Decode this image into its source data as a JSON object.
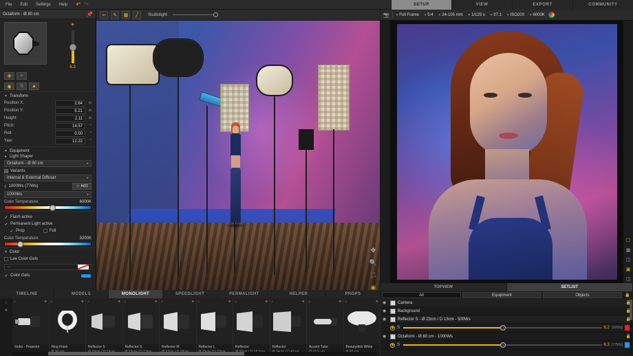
{
  "menu": {
    "items": [
      "File",
      "Edit",
      "Settings",
      "Help"
    ],
    "undo_icon": "undo-arrow-icon",
    "redo_icon": "redo-arrow-icon"
  },
  "topnav": {
    "tabs": [
      "SETUP",
      "VIEW",
      "EXPORT",
      "COMMUNITY"
    ],
    "active": "SETUP"
  },
  "left_panel": {
    "title": "Octaform - Ø 80 cm",
    "pin_icon": "pin-icon",
    "preview_icon": "octabox-preview-icon",
    "power_value": "6.3",
    "icon_row_1": [
      "move-icon",
      "target-icon"
    ],
    "icon_row_2": [
      "power-icon",
      "sync-icon",
      "tripod-icon"
    ],
    "transform": {
      "title": "Transform",
      "rows": [
        {
          "label": "Position X:",
          "value": "2.64",
          "unit": "m"
        },
        {
          "label": "Position Y:",
          "value": "5.21",
          "unit": "m"
        },
        {
          "label": "Height:",
          "value": "2.11",
          "unit": "m"
        },
        {
          "label": "Pitch:",
          "value": "14.57",
          "unit": "°"
        },
        {
          "label": "Roll:",
          "value": "0.00",
          "unit": "°"
        },
        {
          "label": "Yaw:",
          "value": "12.22",
          "unit": "°"
        }
      ]
    },
    "equipment": {
      "title": "Equipment",
      "light_shaper_label": "Light Shaper",
      "light_shaper_value": "Octaform - Ø 80 cm",
      "variants_label": "Variants",
      "variants_value": "Internal & External Diffuser",
      "watt_label": "1000Ws (77Ws)",
      "add_button": "ADD",
      "generator_value": "1000Ws",
      "color_temp_label": "Color Temperature",
      "color_temp_value": "6000K"
    },
    "flash": {
      "flash_active": "Flash active",
      "permanent_active": "Permanent Light active",
      "prop": "Prop",
      "full": "Full",
      "color_temp_label": "Color Temperature",
      "color_temp_value": "3200K"
    },
    "color": {
      "title": "Color",
      "lee_gels_label": "Lee Color Gels",
      "lee_gels_value": "---",
      "color_gels_label": "Color Gels",
      "color_gels_swatch": "#1e9ae8"
    }
  },
  "viewport_toolbar": {
    "icons": [
      "cursor-icon",
      "pen-icon",
      "grid-icon",
      "ruler-icon"
    ],
    "studiolight_label": "Studiolight"
  },
  "viewport": {
    "icons": [
      "move-tool-icon",
      "zoom-tool-icon",
      "fullscreen-icon",
      "orbit-icon"
    ]
  },
  "camera_bar": {
    "camera_icon": "camera-icon",
    "settings": [
      "Full Frame",
      "5:4",
      "24-105 mm",
      "1/125 s",
      "f/7.1",
      "ISO200",
      "6000K"
    ],
    "color_icon": "color-wheel-icon"
  },
  "right_side_icons": [
    "crop-icon",
    "grid4-icon",
    "ratio-icon",
    "frame-icon",
    "compare-icon"
  ],
  "bottom_tabs": {
    "tabs": [
      "TIMELINE",
      "MODELS",
      "MONOLIGHT",
      "SPEEDLIGHT",
      "PERMALIGHT",
      "HELPER",
      "PROPS"
    ],
    "active": "MONOLIGHT"
  },
  "thumbnails": [
    {
      "name": "Gobo - Projector",
      "spec": ""
    },
    {
      "name": "Ring Flash",
      "spec": "Ø 30 cm"
    },
    {
      "name": "Reflector S",
      "spec": "Ø 18cm / D 13cm"
    },
    {
      "name": "Reflector S",
      "spec": "Ø 23cm / D 13cm"
    },
    {
      "name": "Reflector M",
      "spec": "Ø 23cm / D 18cm"
    },
    {
      "name": "Reflector L",
      "spec": "Ø 23cm / D 23cm"
    },
    {
      "name": "Reflector",
      "spec": "Ø 30cm / D 18,5cm"
    },
    {
      "name": "Reflector",
      "spec": "Ø 34cm / D 41cm"
    },
    {
      "name": "Accent Tube",
      "spec": "Ø 10,5 cm"
    },
    {
      "name": "Beautydish White",
      "spec": "Ø 56 cm"
    }
  ],
  "setlist": {
    "tabs": [
      "TOPVIEW",
      "SETLIST"
    ],
    "active_tab": "SETLIST",
    "filters": [
      "All",
      "Equipment",
      "Objects"
    ],
    "active_filter": "All",
    "lock_icon": "lock-icon",
    "layers": [
      {
        "name": "Camera",
        "icon": "camera-layer-icon",
        "has_slider": false
      },
      {
        "name": "Background",
        "icon": "background-layer-icon",
        "has_slider": false
      },
      {
        "name": "Reflector S - Ø 23cm / D 13cm - 500Ws",
        "icon": "reflector-layer-icon",
        "has_slider": true,
        "slider_label": "S",
        "value": "6.2",
        "watts": "(36Ws)",
        "swatch": "#ef2020"
      },
      {
        "name": "Octaform - Ø 80 cm - 1000Ws",
        "icon": "octabox-layer-icon",
        "has_slider": true,
        "slider_label": "S",
        "value": "6.3",
        "watts": "(77Ws)",
        "swatch": "#1e9ae8"
      }
    ]
  }
}
